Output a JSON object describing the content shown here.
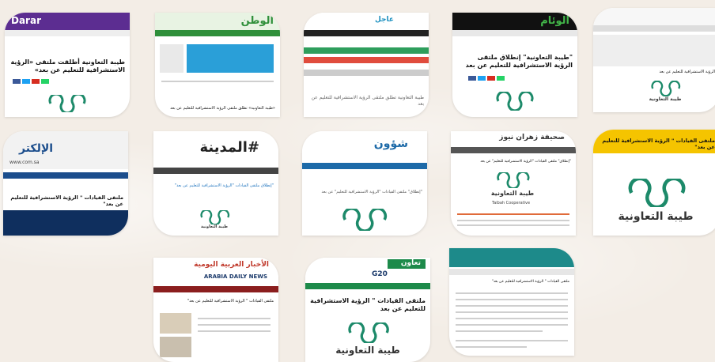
{
  "cards": {
    "c1": {
      "site": "Darar",
      "headline": "طيبة التعاونية أطلقت ملتقى «الرؤية الاستشرافية للتعليم عن بعد»"
    },
    "c2": {
      "site": "الوطن",
      "headline": "«طيبة التعاونية» تطلق ملتقى الرؤية الاستشرافية للتعليم عن بعد"
    },
    "c3": {
      "site": "عاجل",
      "headline": "طيبة التعاونية تطلق ملتقى الرؤية الاستشرافية للتعليم عن بعد"
    },
    "c4": {
      "site": "الوئام",
      "headline": "\"طيبة التعاونية\" إنطلاق ملتقى الرؤية الاستشرافية للتعليم عن بعد"
    },
    "c5": {
      "site": "",
      "headline": "الرؤية الاستشرافية للتعليم عن بعد",
      "tname": "طيبة التعاونية"
    },
    "c6": {
      "site": "الإلكتر",
      "url": "www.com.sa",
      "headline": "ملتقى القيادات \" الرؤية الاستشرافية للتعليم عن بعد\""
    },
    "c7": {
      "site": "#المدينة",
      "headline": "\"إنطلاق ملتقى القيادات \"الرؤية الاستشرافية للتعليم عن بعد\"",
      "tname": "طيبة التعاونية"
    },
    "c8": {
      "site": "شؤون",
      "headline": "\"إنطلاق\" ملتقى القيادات \"الرؤية الاستشرافية للتعليم\" عن بعد"
    },
    "c9": {
      "site": "صحيفة زهران نيوز",
      "headline": "\"إنطلاق\" ملتقى القيادات \"الرؤية الاستشرافية للتعليم\" عن بعد",
      "tname": "طيبة التعاونية",
      "tname_en": "Taibah Cooperative"
    },
    "c10": {
      "headline": "ملتقى القيادات \" الرؤية الاستشرافية للتعليم عن بعد\"",
      "tname": "طيبة التعاونية"
    },
    "c11": {
      "site": "الأخبار العربية اليومية",
      "url": "ARABIA DAILY NEWS",
      "headline": "ملتقى القيادات \" الرؤية الاستشرافية للتعليم عن بعد\""
    },
    "c12": {
      "site": "تعاون",
      "tag": "G20",
      "headline": "ملتقى القيادات \" الرؤية الاستشرافية للتعليم عن بعد",
      "tname": "طيبة التعاونية"
    },
    "c13": {
      "headline": "ملتقى القيادات \" الرؤية الاستشرافية للتعليم عن بعد\""
    }
  },
  "colors": {
    "taibah_green": "#1d8a6a",
    "bg": "#f3ede6",
    "yellow": "#f5c400"
  }
}
